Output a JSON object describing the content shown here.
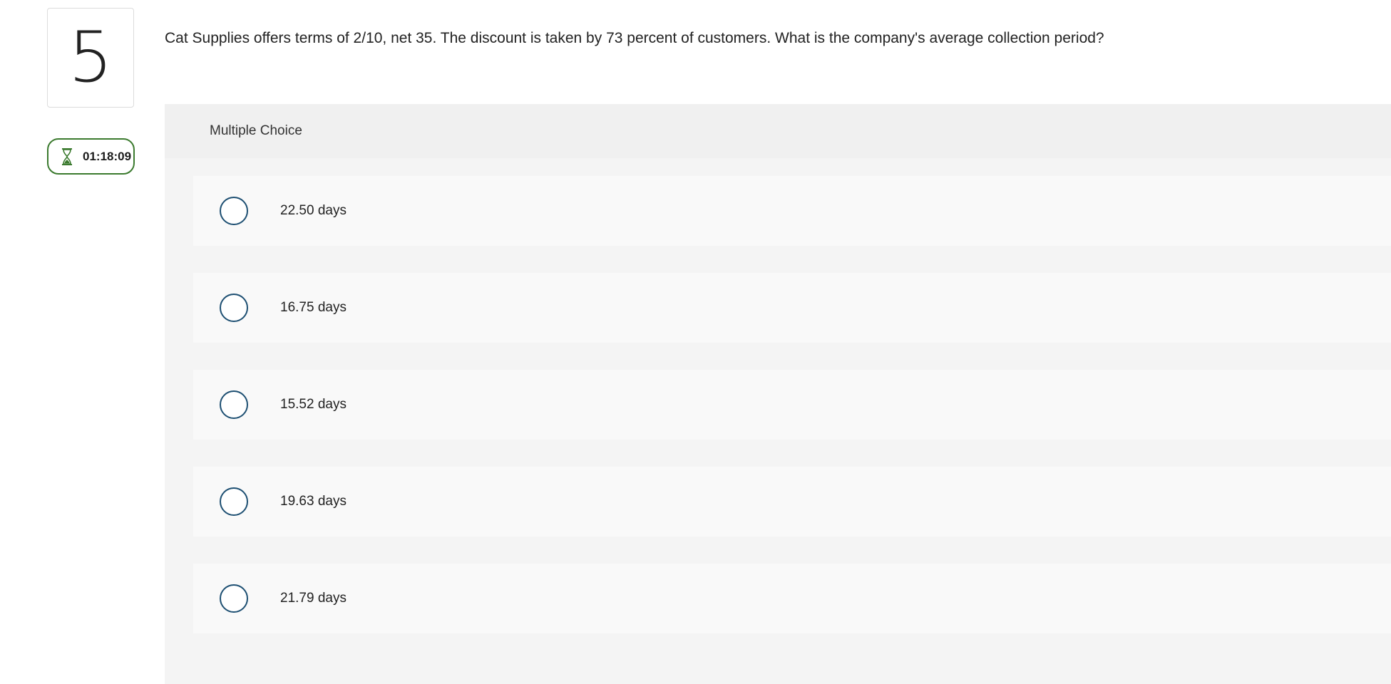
{
  "question": {
    "number": "5",
    "text": "Cat Supplies offers terms of 2/10, net 35. The discount is taken by 73 percent of customers. What is the company's average collection period?"
  },
  "timer": {
    "icon": "hourglass-icon",
    "value": "01:18:09",
    "color": "#3b7a2e"
  },
  "multiple_choice": {
    "header": "Multiple Choice",
    "options": [
      {
        "label": "22.50 days"
      },
      {
        "label": "16.75 days"
      },
      {
        "label": "15.52 days"
      },
      {
        "label": "19.63 days"
      },
      {
        "label": "21.79 days"
      }
    ],
    "radio_color": "#1d4f72"
  }
}
